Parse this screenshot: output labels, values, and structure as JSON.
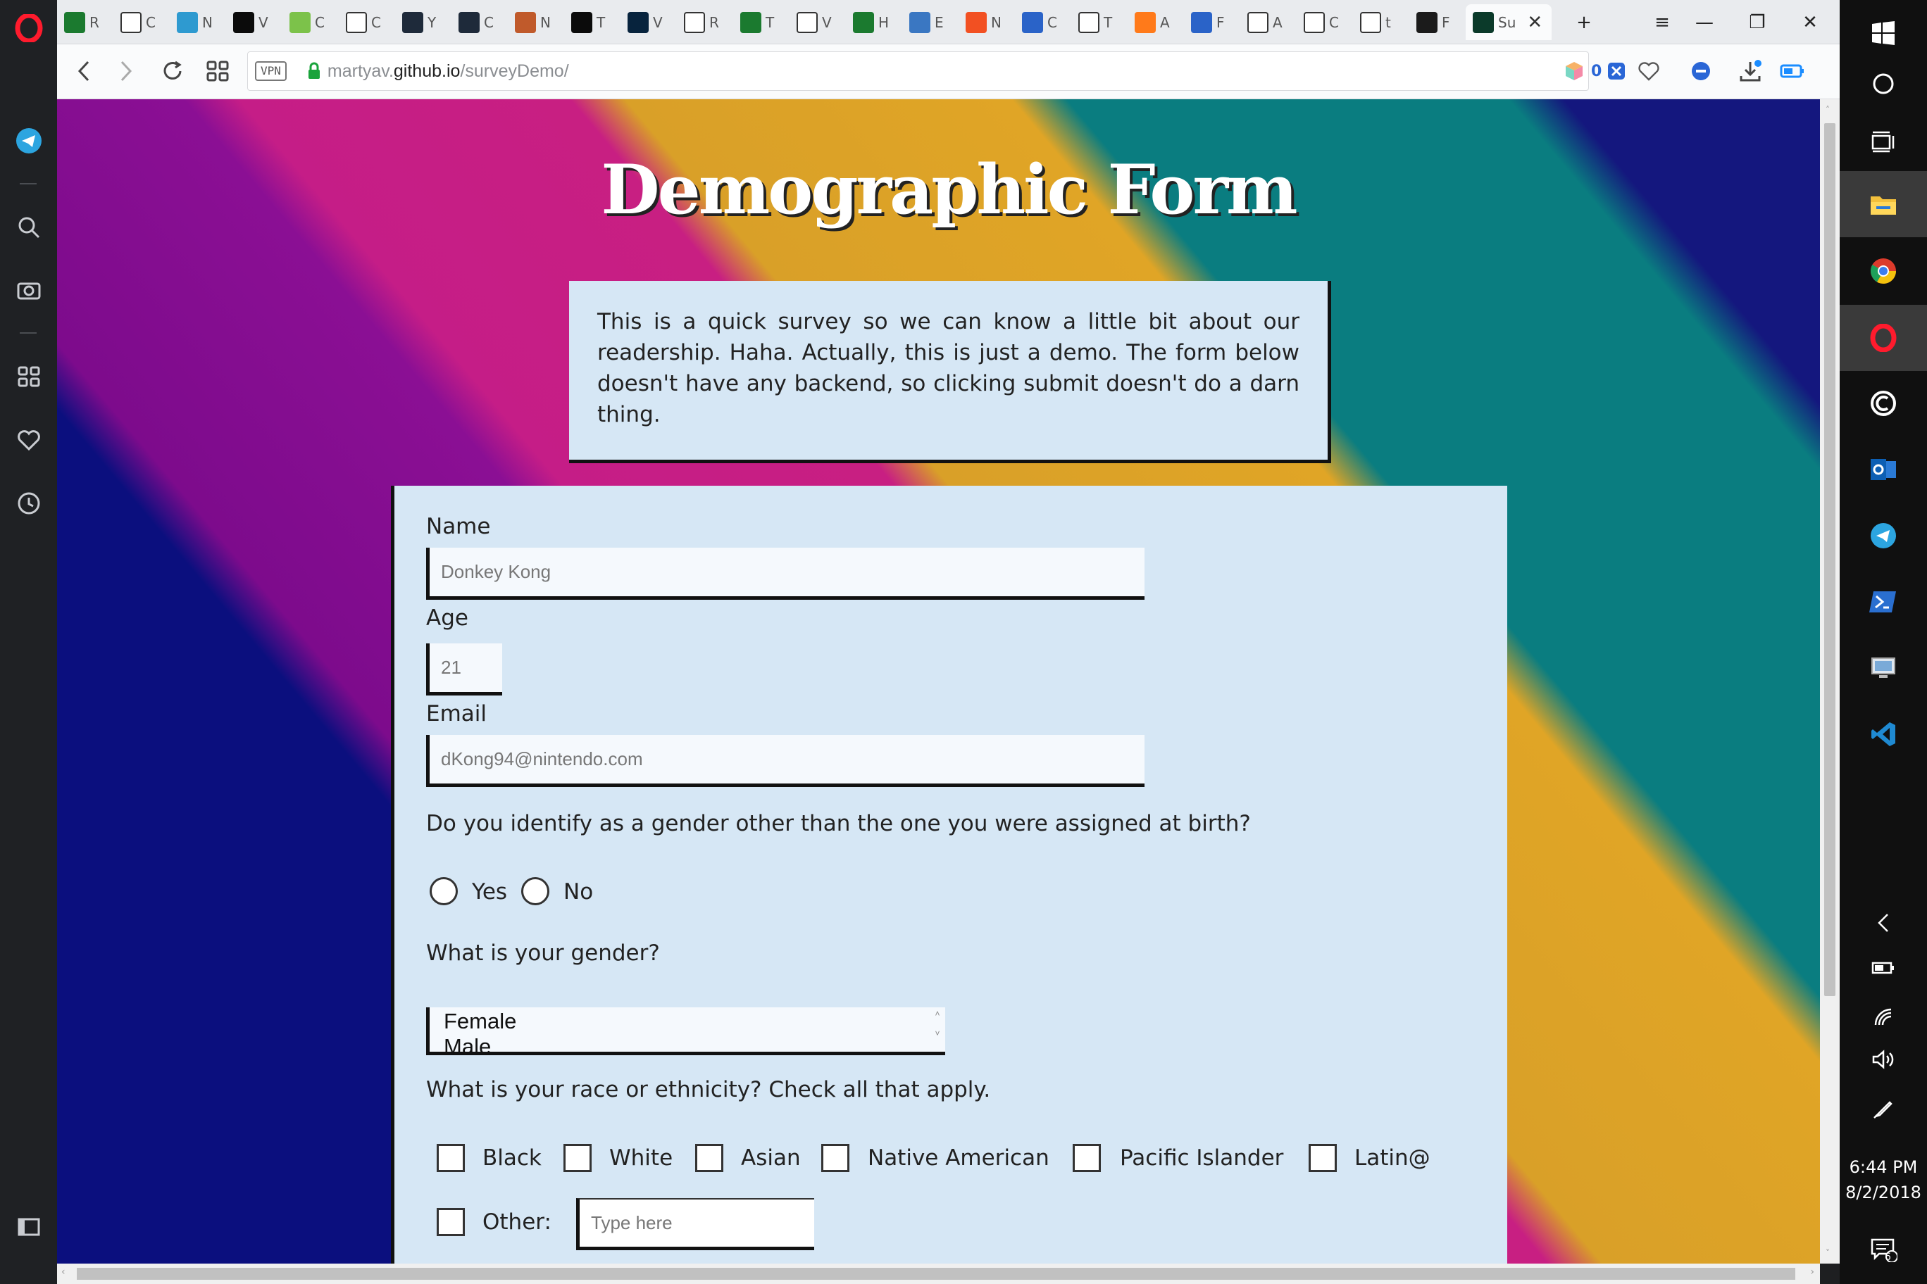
{
  "tabs": [
    {
      "label": "R",
      "color": "#1b7a2f",
      "icon": "hackerrank-icon"
    },
    {
      "label": "C",
      "color": "#ffffff",
      "icon": "codepen-icon"
    },
    {
      "label": "N",
      "color": "#2e9ad0",
      "icon": "bird-icon"
    },
    {
      "label": "V",
      "color": "#0b0b0b",
      "icon": "dev-icon"
    },
    {
      "label": "C",
      "color": "#7cc24a",
      "icon": "code-icon"
    },
    {
      "label": "C",
      "color": "#ffffff",
      "icon": "circle-dots-icon"
    },
    {
      "label": "Y",
      "color": "#1e2a3a",
      "icon": "react-icon"
    },
    {
      "label": "C",
      "color": "#1e2a3a",
      "icon": "react-icon"
    },
    {
      "label": "N",
      "color": "#c05a2b",
      "icon": "people-icon"
    },
    {
      "label": "T",
      "color": "#0b0b0b",
      "icon": "dev-icon"
    },
    {
      "label": "V",
      "color": "#07233d",
      "icon": "wave-icon"
    },
    {
      "label": "R",
      "color": "#ffffff",
      "icon": "prompt-icon"
    },
    {
      "label": "T",
      "color": "#1b7a2f",
      "icon": "hackerrank-icon"
    },
    {
      "label": "V",
      "color": "#ffffff",
      "icon": "v-icon"
    },
    {
      "label": "H",
      "color": "#1b7a2f",
      "icon": "hackerrank-icon"
    },
    {
      "label": "E",
      "color": "#3a77c2",
      "icon": "document-icon"
    },
    {
      "label": "N",
      "color": "#f25022",
      "icon": "microsoft-icon"
    },
    {
      "label": "C",
      "color": "#2a63c8",
      "icon": "css-grid-icon"
    },
    {
      "label": "T",
      "color": "#ffffff",
      "icon": "pin-icon"
    },
    {
      "label": "A",
      "color": "#ff7a1a",
      "icon": "asterisk-icon"
    },
    {
      "label": "F",
      "color": "#2a63c8",
      "icon": "nyc-icon"
    },
    {
      "label": "A",
      "color": "#ffffff",
      "icon": "codepen-icon"
    },
    {
      "label": "C",
      "color": "#ffffff",
      "icon": "codepen-icon"
    },
    {
      "label": "t",
      "color": "#ffffff",
      "icon": "google-icon"
    },
    {
      "label": "F",
      "color": "#1b1b1b",
      "icon": "camera-icon"
    },
    {
      "label": "Su",
      "color": "#0b3a2a",
      "icon": "survey-icon",
      "active": true
    }
  ],
  "address": {
    "vpn": "VPN",
    "host_prefix": "martyav.",
    "host": "github.io",
    "path": "/surveyDemo/",
    "block_count": "0"
  },
  "page": {
    "title": "Demographic Form",
    "intro": "This is a quick survey so we can know a little bit about our readership. Haha. Actually, this is just a demo. The form below doesn't have any backend, so clicking submit doesn't do a darn thing.",
    "name_label": "Name",
    "name_placeholder": "Donkey Kong",
    "age_label": "Age",
    "age_placeholder": "21",
    "email_label": "Email",
    "email_placeholder": "dKong94@nintendo.com",
    "gender_q": "Do you identify as a gender other than the one you were assigned at birth?",
    "yes": "Yes",
    "no": "No",
    "gender_select_q": "What is your gender?",
    "gender_options": [
      "Female",
      "Male"
    ],
    "race_q": "What is your race or ethnicity? Check all that apply.",
    "race_options": [
      "Black",
      "White",
      "Asian",
      "Native American",
      "Pacific Islander",
      "Latin@"
    ],
    "other_label": "Other:",
    "other_placeholder": "Type here"
  },
  "taskbar": {
    "time": "6:44 PM",
    "date": "8/2/2018",
    "notifications": "6"
  },
  "colors": {
    "form_bg": "#d6e7f5",
    "stripe_navy": "#0b0f7e",
    "stripe_purple": "#8b0f94",
    "stripe_magenta": "#c81f82",
    "stripe_gold": "#e0a526",
    "stripe_teal": "#0a7d80"
  }
}
